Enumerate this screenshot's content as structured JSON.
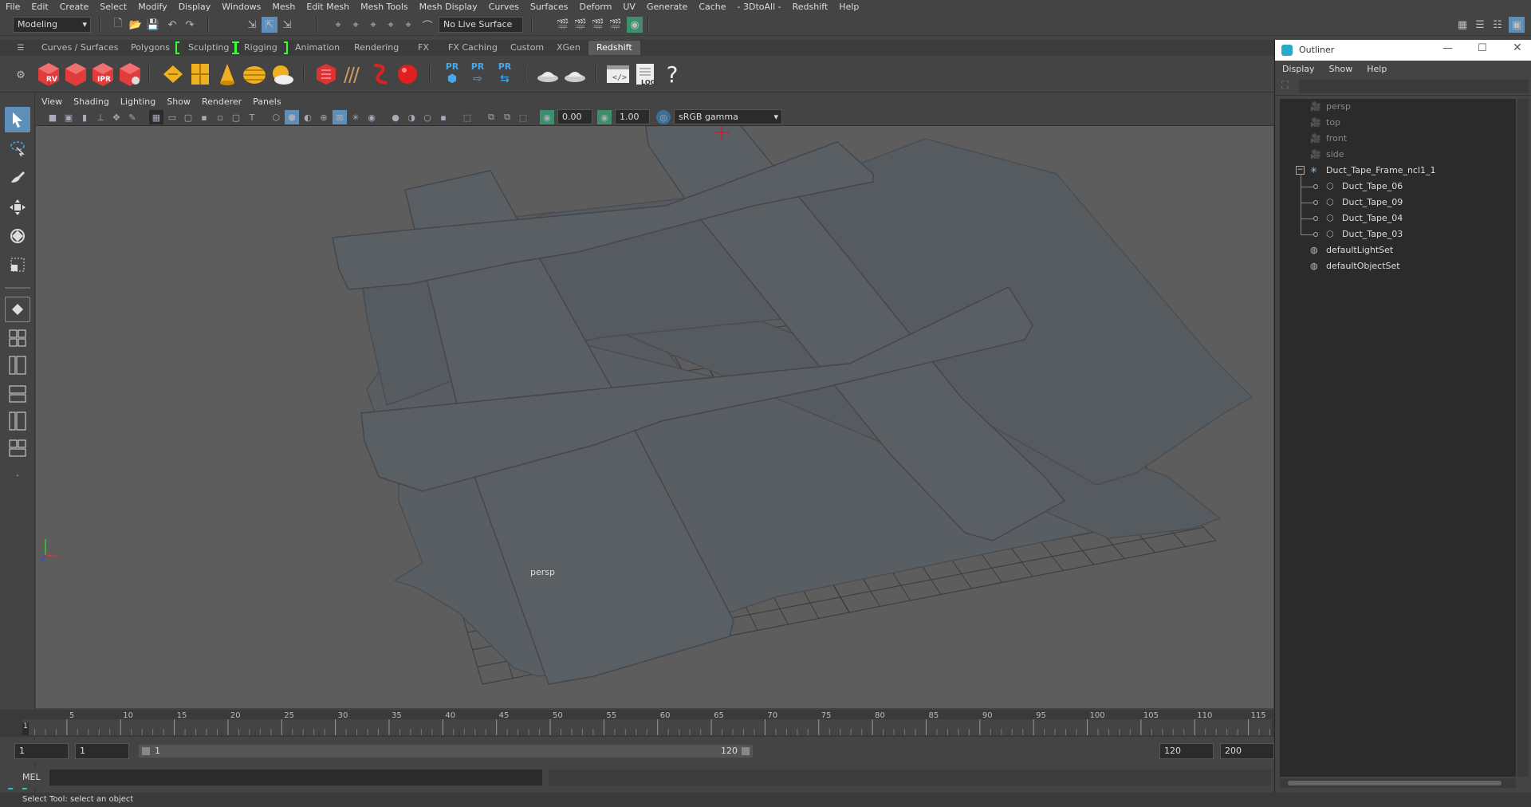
{
  "menubar": [
    "File",
    "Edit",
    "Create",
    "Select",
    "Modify",
    "Display",
    "Windows",
    "Mesh",
    "Edit Mesh",
    "Mesh Tools",
    "Mesh Display",
    "Curves",
    "Surfaces",
    "Deform",
    "UV",
    "Generate",
    "Cache",
    "- 3DtoAll -",
    "Redshift",
    "Help"
  ],
  "status": {
    "mode": "Modeling",
    "live_surface": "No Live Surface"
  },
  "shelf_tabs": [
    "Curves / Surfaces",
    "Polygons",
    "Sculpting",
    "Rigging",
    "Animation",
    "Rendering",
    "FX",
    "FX Caching",
    "Custom",
    "XGen",
    "Redshift"
  ],
  "shelf_active": "Redshift",
  "shelf_labels": {
    "rv": "RV",
    "ipr": "IPR",
    "pr": "PR",
    "log": "LOG",
    "help": "?"
  },
  "viewport_menu": [
    "View",
    "Shading",
    "Lighting",
    "Show",
    "Renderer",
    "Panels"
  ],
  "viewport_toolbar": {
    "exposure": "0.00",
    "gamma": "1.00",
    "colorspace": "sRGB gamma"
  },
  "viewport": {
    "camera_label": "persp"
  },
  "timeline": {
    "ticks": [
      "1",
      "5",
      "10",
      "15",
      "20",
      "25",
      "30",
      "35",
      "40",
      "45",
      "50",
      "55",
      "60",
      "65",
      "70",
      "75",
      "80",
      "85",
      "90",
      "95",
      "100",
      "105",
      "110",
      "115"
    ],
    "current": "1"
  },
  "range": {
    "start": "1",
    "playback_start": "1",
    "slider_start": "1",
    "slider_end": "120",
    "playback_end": "120",
    "end": "200"
  },
  "command": {
    "language": "MEL"
  },
  "help_line": "Select Tool: select an object",
  "outliner": {
    "title": "Outliner",
    "menu": [
      "Display",
      "Show",
      "Help"
    ],
    "items": [
      {
        "label": "persp",
        "type": "camera",
        "indent": 0
      },
      {
        "label": "top",
        "type": "camera",
        "indent": 0
      },
      {
        "label": "front",
        "type": "camera",
        "indent": 0
      },
      {
        "label": "side",
        "type": "camera",
        "indent": 0
      },
      {
        "label": "Duct_Tape_Frame_ncl1_1",
        "type": "group",
        "indent": 0
      },
      {
        "label": "Duct_Tape_06",
        "type": "mesh",
        "indent": 1
      },
      {
        "label": "Duct_Tape_09",
        "type": "mesh",
        "indent": 1
      },
      {
        "label": "Duct_Tape_04",
        "type": "mesh",
        "indent": 1
      },
      {
        "label": "Duct_Tape_03",
        "type": "mesh",
        "indent": 1
      },
      {
        "label": "defaultLightSet",
        "type": "set",
        "indent": 0
      },
      {
        "label": "defaultObjectSet",
        "type": "set",
        "indent": 0
      }
    ]
  },
  "colors": {
    "accent": "#5d8fb9",
    "redshift": "#e03c3c",
    "grid": "#3a3a3a",
    "tape": "#565b60",
    "sculpt_bracket": "#33ff33"
  }
}
